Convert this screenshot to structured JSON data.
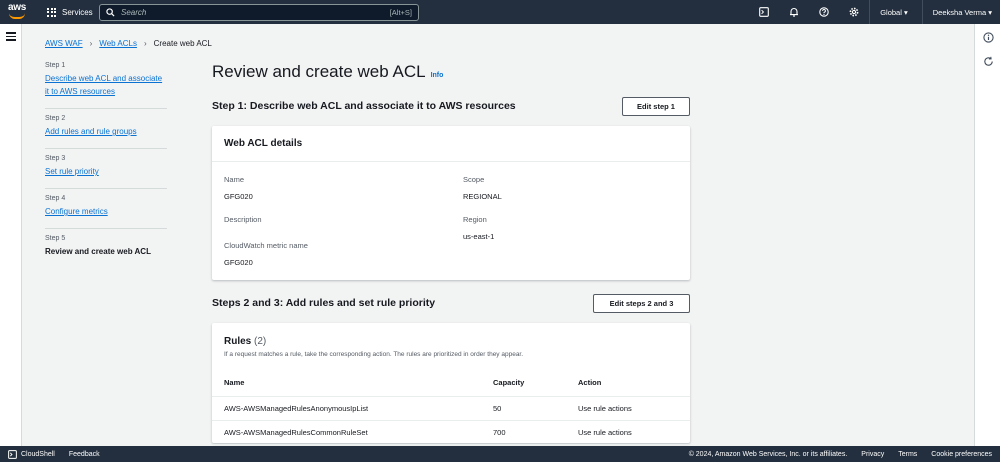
{
  "topbar": {
    "logo": "aws",
    "services_label": "Services",
    "search_placeholder": "Search",
    "search_shortcut": "[Alt+S]",
    "region": "Global",
    "user": "Deeksha Verma",
    "icons": [
      "cloudshell-icon",
      "bell-icon",
      "help-icon",
      "gear-icon"
    ]
  },
  "breadcrumb": {
    "items": [
      "AWS WAF",
      "Web ACLs"
    ],
    "current": "Create web ACL"
  },
  "steps": [
    {
      "num": "Step 1",
      "label": "Describe web ACL and associate it to AWS resources",
      "link": true
    },
    {
      "num": "Step 2",
      "label": "Add rules and rule groups",
      "link": true
    },
    {
      "num": "Step 3",
      "label": "Set rule priority",
      "link": true
    },
    {
      "num": "Step 4",
      "label": "Configure metrics",
      "link": true
    },
    {
      "num": "Step 5",
      "label": "Review and create web ACL",
      "link": false
    }
  ],
  "page": {
    "title": "Review and create web ACL",
    "info": "Info"
  },
  "section1": {
    "heading": "Step 1: Describe web ACL and associate it to AWS resources",
    "edit_button": "Edit step 1",
    "card_title": "Web ACL details",
    "name_label": "Name",
    "name_value": "GFG020",
    "description_label": "Description",
    "metric_label": "CloudWatch metric name",
    "metric_value": "GFG020",
    "scope_label": "Scope",
    "scope_value": "REGIONAL",
    "region_label": "Region",
    "region_value": "us-east-1"
  },
  "section2": {
    "heading": "Steps 2 and 3: Add rules and set rule priority",
    "edit_button": "Edit steps 2 and 3",
    "rules_title": "Rules",
    "rules_count": "(2)",
    "rules_desc": "If a request matches a rule, take the corresponding action. The rules are prioritized in order they appear.",
    "columns": [
      "Name",
      "Capacity",
      "Action"
    ],
    "rows": [
      {
        "name": "AWS-AWSManagedRulesAnonymousIpList",
        "capacity": "50",
        "action": "Use rule actions"
      },
      {
        "name": "AWS-AWSManagedRulesCommonRuleSet",
        "capacity": "700",
        "action": "Use rule actions"
      }
    ]
  },
  "footer": {
    "cloudshell": "CloudShell",
    "feedback": "Feedback",
    "copyright": "© 2024, Amazon Web Services, Inc. or its affiliates.",
    "privacy": "Privacy",
    "terms": "Terms",
    "cookie": "Cookie preferences"
  }
}
